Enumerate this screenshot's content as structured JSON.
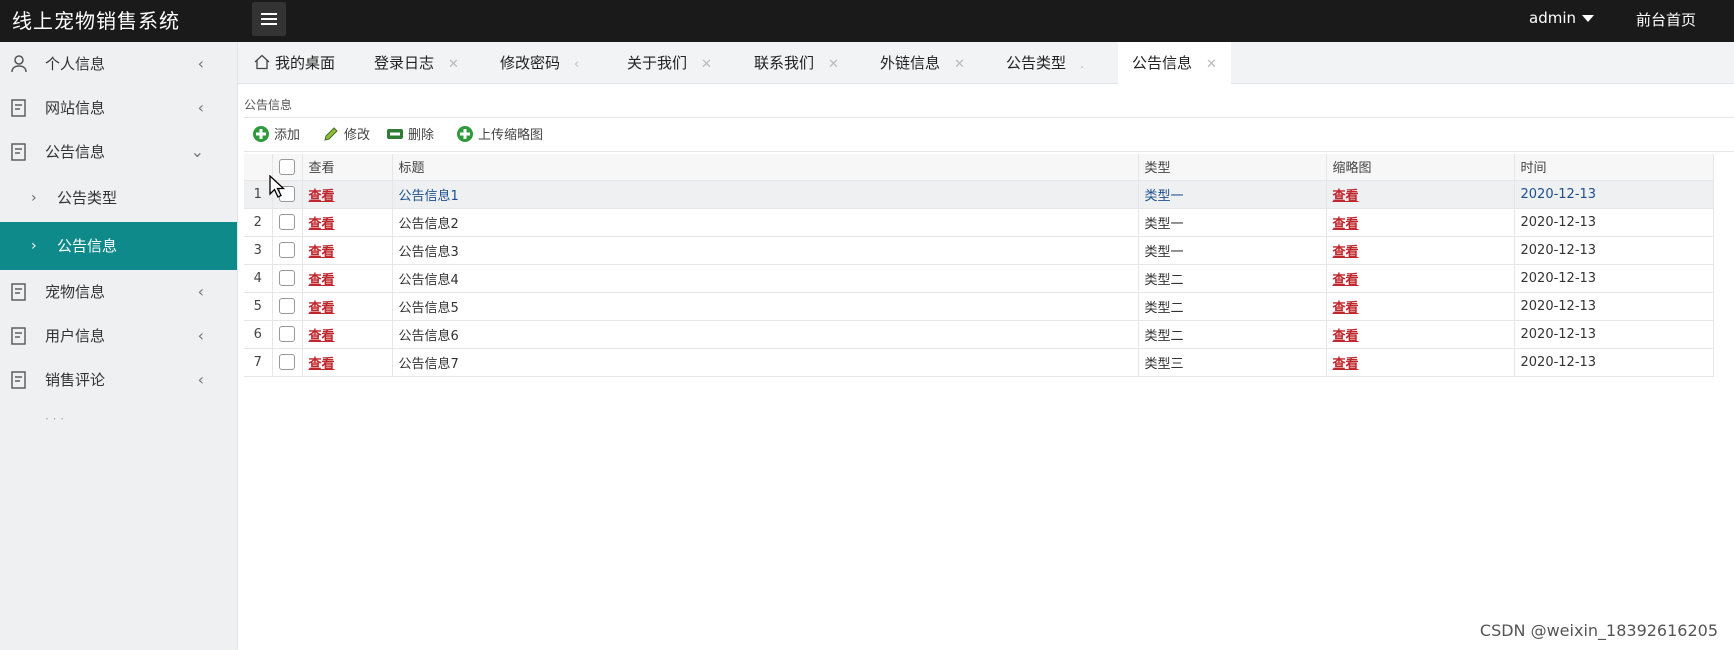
{
  "app": {
    "title": "线上宠物销售系统"
  },
  "topbar": {
    "user": "admin",
    "front_link": "前台首页"
  },
  "sidebar": {
    "items": [
      {
        "label": "个人信息",
        "chevron": "<"
      },
      {
        "label": "网站信息",
        "chevron": "<"
      },
      {
        "label": "公告信息",
        "chevron": "v"
      },
      {
        "label": "宠物信息",
        "chevron": "<"
      },
      {
        "label": "用户信息",
        "chevron": "<"
      },
      {
        "label": "销售评论",
        "chevron": "<"
      }
    ],
    "subitems": [
      {
        "label": "公告类型",
        "active": false
      },
      {
        "label": "公告信息",
        "active": true
      }
    ],
    "active_color": "#0e8a8b"
  },
  "tabs": [
    {
      "label": "我的桌面",
      "active": false
    },
    {
      "label": "登录日志",
      "active": false
    },
    {
      "label": "修改密码",
      "active": false
    },
    {
      "label": "关于我们",
      "active": false
    },
    {
      "label": "联系我们",
      "active": false
    },
    {
      "label": "外链信息",
      "active": false
    },
    {
      "label": "公告类型",
      "active": false
    },
    {
      "label": "公告信息",
      "active": true
    }
  ],
  "panel": {
    "title": "公告信息"
  },
  "toolbar": {
    "add": "添加",
    "edit": "修改",
    "delete": "删除",
    "upload": "上传缩略图"
  },
  "table": {
    "columns": [
      "查看",
      "标题",
      "类型",
      "缩略图",
      "时间"
    ],
    "rows": [
      {
        "num": "1",
        "view": "查看",
        "title": "公告信息1",
        "type": "类型一",
        "thumb": "查看",
        "time": "2020-12-13"
      },
      {
        "num": "2",
        "view": "查看",
        "title": "公告信息2",
        "type": "类型一",
        "thumb": "查看",
        "time": "2020-12-13"
      },
      {
        "num": "3",
        "view": "查看",
        "title": "公告信息3",
        "type": "类型一",
        "thumb": "查看",
        "time": "2020-12-13"
      },
      {
        "num": "4",
        "view": "查看",
        "title": "公告信息4",
        "type": "类型二",
        "thumb": "查看",
        "time": "2020-12-13"
      },
      {
        "num": "5",
        "view": "查看",
        "title": "公告信息5",
        "type": "类型二",
        "thumb": "查看",
        "time": "2020-12-13"
      },
      {
        "num": "6",
        "view": "查看",
        "title": "公告信息6",
        "type": "类型二",
        "thumb": "查看",
        "time": "2020-12-13"
      },
      {
        "num": "7",
        "view": "查看",
        "title": "公告信息7",
        "type": "类型三",
        "thumb": "查看",
        "time": "2020-12-13"
      }
    ]
  },
  "watermark": "CSDN @weixin_18392616205"
}
